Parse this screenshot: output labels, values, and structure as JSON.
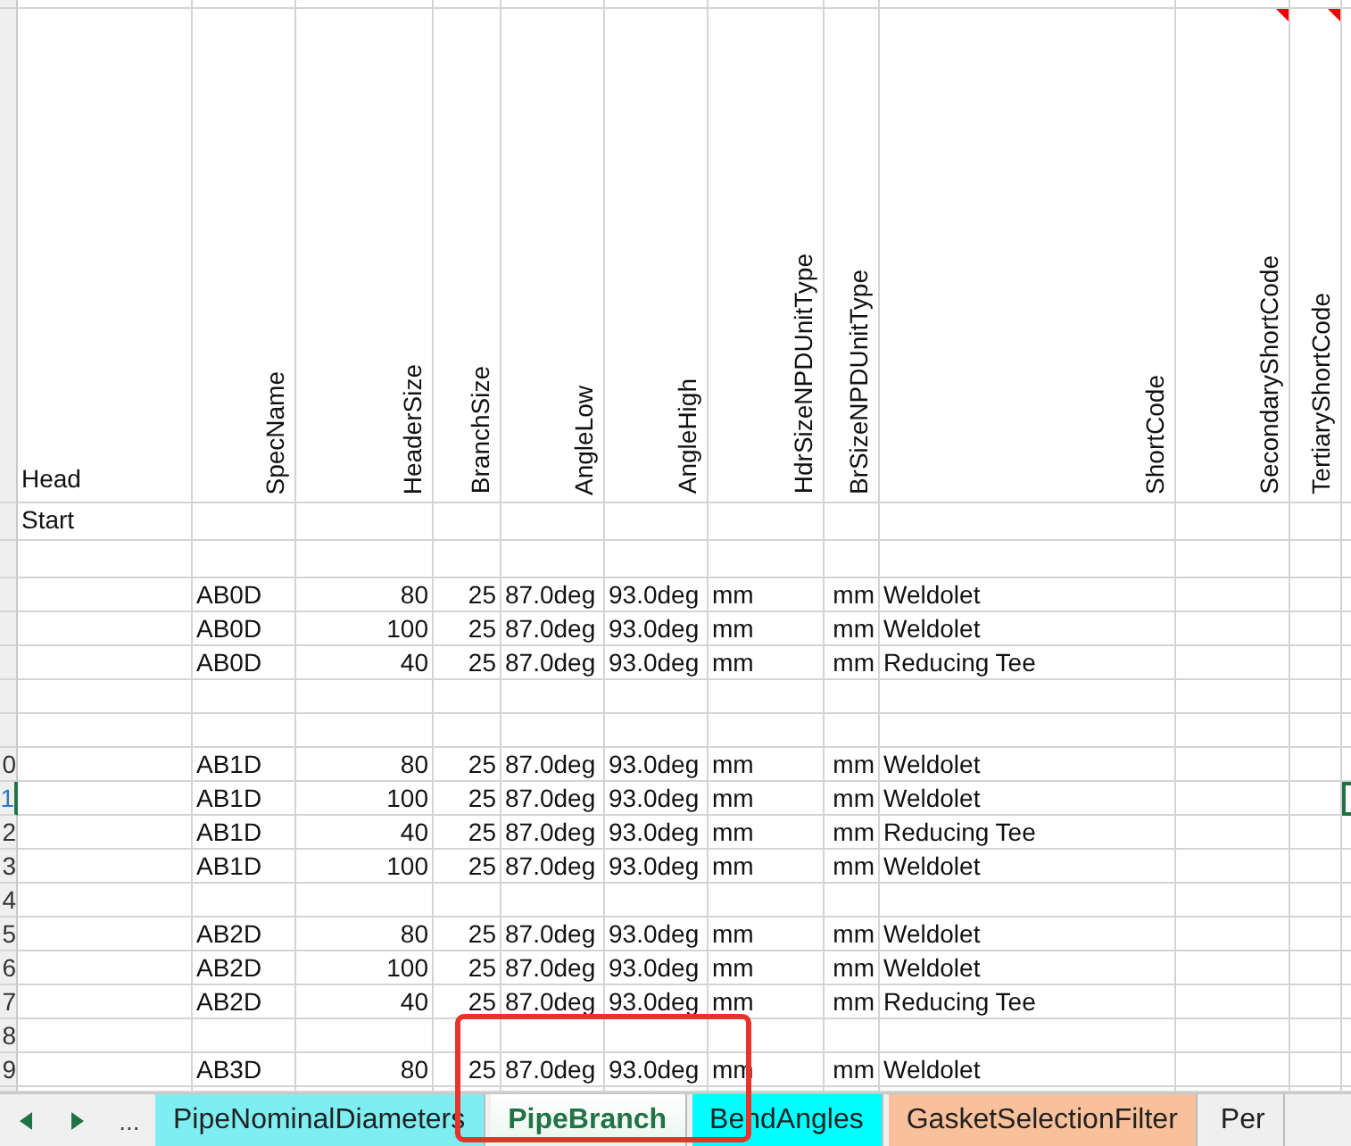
{
  "columns": [
    {
      "label": "Head",
      "vertical": false,
      "comment": false
    },
    {
      "label": "SpecName",
      "vertical": true,
      "comment": false
    },
    {
      "label": "HeaderSize",
      "vertical": true,
      "comment": false
    },
    {
      "label": "BranchSize",
      "vertical": true,
      "comment": false
    },
    {
      "label": "AngleLow",
      "vertical": true,
      "comment": false
    },
    {
      "label": "AngleHigh",
      "vertical": true,
      "comment": false
    },
    {
      "label": "HdrSizeNPDUnitType",
      "vertical": true,
      "comment": false
    },
    {
      "label": "BrSizeNPDUnitType",
      "vertical": true,
      "comment": false
    },
    {
      "label": "ShortCode",
      "vertical": true,
      "comment": false
    },
    {
      "label": "SecondaryShortCode",
      "vertical": true,
      "comment": true
    },
    {
      "label": "TertiaryShortCode",
      "vertical": true,
      "comment": true
    }
  ],
  "rows": [
    {
      "kind": "label",
      "text": "Start"
    },
    {
      "kind": "blank"
    },
    {
      "kind": "data",
      "cells": [
        "AB0D",
        "80",
        "25",
        "87.0deg",
        "93.0deg",
        "mm",
        "mm",
        "Weldolet"
      ]
    },
    {
      "kind": "data",
      "cells": [
        "AB0D",
        "100",
        "25",
        "87.0deg",
        "93.0deg",
        "mm",
        "mm",
        "Weldolet"
      ]
    },
    {
      "kind": "data",
      "cells": [
        "AB0D",
        "40",
        "25",
        "87.0deg",
        "93.0deg",
        "mm",
        "mm",
        "Reducing Tee"
      ]
    },
    {
      "kind": "blank"
    },
    {
      "kind": "blank"
    },
    {
      "kind": "data",
      "row_number": "0",
      "selected": false,
      "cells": [
        "AB1D",
        "80",
        "25",
        "87.0deg",
        "93.0deg",
        "mm",
        "mm",
        "Weldolet"
      ]
    },
    {
      "kind": "data",
      "row_number": "1",
      "selected": true,
      "cells": [
        "AB1D",
        "100",
        "25",
        "87.0deg",
        "93.0deg",
        "mm",
        "mm",
        "Weldolet"
      ]
    },
    {
      "kind": "data",
      "row_number": "2",
      "selected": false,
      "cells": [
        "AB1D",
        "40",
        "25",
        "87.0deg",
        "93.0deg",
        "mm",
        "mm",
        "Reducing Tee"
      ]
    },
    {
      "kind": "data",
      "row_number": "3",
      "selected": false,
      "cells": [
        "AB1D",
        "100",
        "25",
        "87.0deg",
        "93.0deg",
        "mm",
        "mm",
        "Weldolet"
      ]
    },
    {
      "kind": "blank",
      "row_number": "4",
      "selected": false
    },
    {
      "kind": "data",
      "row_number": "5",
      "selected": false,
      "cells": [
        "AB2D",
        "80",
        "25",
        "87.0deg",
        "93.0deg",
        "mm",
        "mm",
        "Weldolet"
      ]
    },
    {
      "kind": "data",
      "row_number": "6",
      "selected": false,
      "cells": [
        "AB2D",
        "100",
        "25",
        "87.0deg",
        "93.0deg",
        "mm",
        "mm",
        "Weldolet"
      ]
    },
    {
      "kind": "data",
      "row_number": "7",
      "selected": false,
      "cells": [
        "AB2D",
        "40",
        "25",
        "87.0deg",
        "93.0deg",
        "mm",
        "mm",
        "Reducing Tee"
      ]
    },
    {
      "kind": "blank",
      "row_number": "8",
      "selected": false
    },
    {
      "kind": "data",
      "row_number": "9",
      "selected": false,
      "cells": [
        "AB3D",
        "80",
        "25",
        "87.0deg",
        "93.0deg",
        "mm",
        "mm",
        "Weldolet"
      ]
    }
  ],
  "sheet_tabs": {
    "overflow": "...",
    "tabs": [
      {
        "label": "PipeNominalDiameters",
        "selected": false,
        "color": "#7eeef2"
      },
      {
        "label": "PipeBranch",
        "selected": true,
        "color": "#ffffff"
      },
      {
        "label": "BendAngles",
        "selected": false,
        "color": "#00ffff"
      },
      {
        "label": "GasketSelectionFilter",
        "selected": false,
        "color": "#f8c19b"
      },
      {
        "label": "Per",
        "selected": false,
        "color": "#efefef"
      }
    ]
  },
  "highlight_box": true
}
